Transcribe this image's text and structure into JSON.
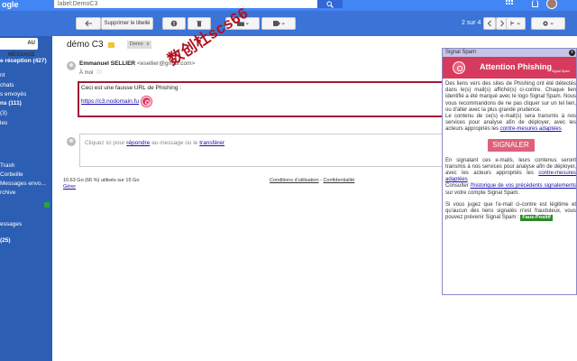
{
  "topbar": {
    "logo": "ogle",
    "search_value": "label:DemoC3"
  },
  "toolbar": {
    "delete_label_button": "Supprimer le libellé",
    "pager": "2 sur 4"
  },
  "sidebar": {
    "compose": "AU MESSAGE",
    "items": [
      "e réception (427)",
      "",
      "nt",
      "chats",
      "s envoyés",
      "ns (111)",
      "(3)",
      "les",
      "Trash",
      "Corbeille",
      "Messages envo...",
      "rchive",
      "essages",
      "(25)"
    ]
  },
  "main": {
    "subject": "démo C3",
    "chip_label": "Demo",
    "chip_close": "x",
    "sender_name": "Emmanuel SELLIER",
    "sender_email": "<esellier@gmail.com>",
    "to": "À moi",
    "body_line": "Ceci est une fausse URL de Phishing :",
    "body_link": "https://c3.nodomain.fu",
    "reply_prefix": "Cliquez ici pour ",
    "reply_link1": "répondre",
    "reply_mid": " au message ou le ",
    "reply_link2": "transférer",
    "storage": "10,63 Go (66 %) utilisés sur 15 Go",
    "manage": "Gérer",
    "footer_terms": "Conditions d'utilisation",
    "footer_sep": " - ",
    "footer_privacy": "Confidentialité"
  },
  "watermark": "数创杜scs66",
  "panel": {
    "header": "Signal Spam",
    "close": "x",
    "banner_title": "Attention Phishing",
    "banner_sub": "Signal Spam",
    "p1": "Des liens vers des sites de Phishing ont été détectés dans le(s) mail(s) affiché(s) ci-contre. Chaque lien identifié a été marqué avec le logo Signal Spam. Nous vous recommandons de ne pas cliquer sur un tel lien, ou d'aller avec la plus grande prudence.",
    "p2": "Le contenu de ce(s) e-mail(s) sera transmis à nos services pour analyse afin de déployer, avec les acteurs appropriés les ",
    "p2_link": "contre-mesures adaptées",
    "signal_button": "SIGNALER",
    "p3": "En signalant ces e-mails, leurs contenus seront transmis à nos services pour analyse afin de déployer, avec les acteurs appropriés les ",
    "p3_link": "contre-mesures adaptées",
    "p4_prefix": "Consulter ",
    "p4_link": "l'historique de vos précédents signalements",
    "p4_suffix": " sur votre compte Signal Spam.",
    "p5": "Si vous jugez que l'e-mail ci-contre est légitime et qu'aucun des liens signalés n'est frauduleux, vous pouvez prévenir Signal Spam : ",
    "faux_positif": "Faux-Positif"
  }
}
